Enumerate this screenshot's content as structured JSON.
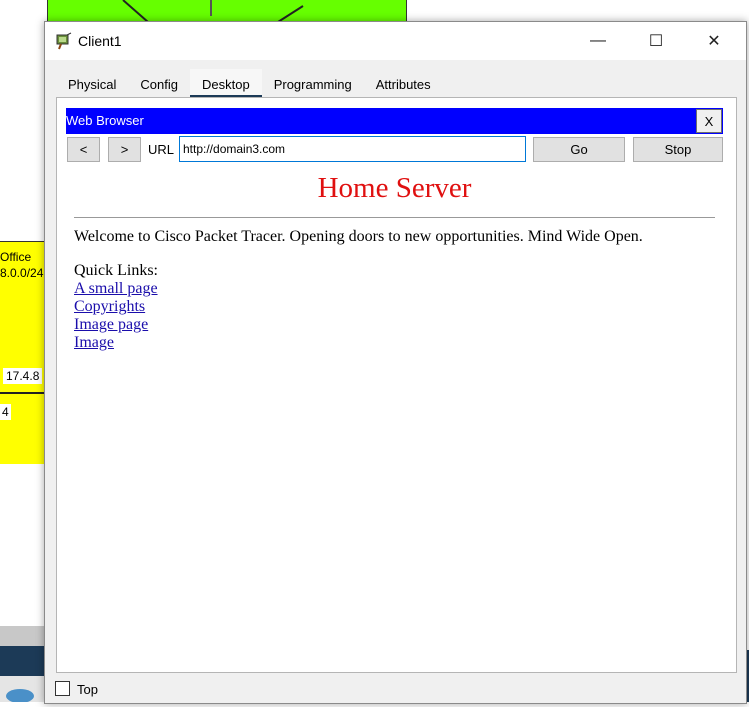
{
  "background": {
    "office_label": "Office",
    "subnet_label": "8.0.0/24",
    "ip_label": "17.4.8",
    "small_label": "4"
  },
  "window": {
    "title": "Client1",
    "icon": "client-pc-icon",
    "controls": {
      "minimize": "—",
      "maximize": "☐",
      "close": "✕"
    }
  },
  "tabs": [
    {
      "label": "Physical",
      "active": false
    },
    {
      "label": "Config",
      "active": false
    },
    {
      "label": "Desktop",
      "active": true
    },
    {
      "label": "Programming",
      "active": false
    },
    {
      "label": "Attributes",
      "active": false
    }
  ],
  "browser": {
    "title": "Web Browser",
    "close_label": "X",
    "back_label": "<",
    "forward_label": ">",
    "url_label": "URL",
    "url_value": "http://domain3.com",
    "go_label": "Go",
    "stop_label": "Stop",
    "title_bar_color": "#0000ff"
  },
  "page": {
    "heading": "Home Server",
    "heading_color": "#e01010",
    "welcome": "Welcome to Cisco Packet Tracer. Opening doors to new opportunities. Mind Wide Open.",
    "quick_links_label": "Quick Links:",
    "links": [
      {
        "label": "A small page"
      },
      {
        "label": "Copyrights"
      },
      {
        "label": "Image page"
      },
      {
        "label": "Image"
      }
    ]
  },
  "footer": {
    "top_label": "Top",
    "top_checked": false
  }
}
